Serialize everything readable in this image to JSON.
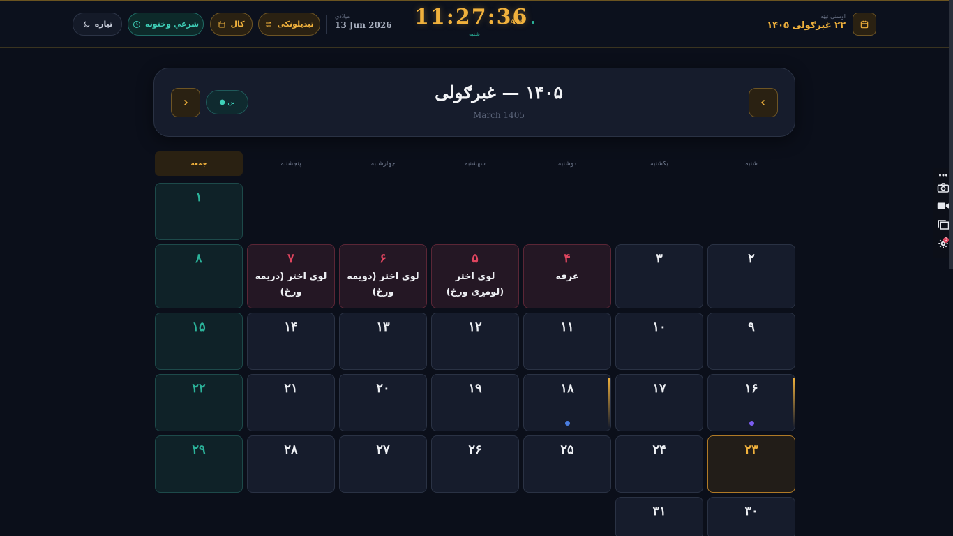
{
  "header": {
    "theme_label": "تیاره",
    "prayer_label": "شرعي وختونه",
    "year_label": "کال",
    "convert_label": "تبدیلونکی",
    "gregorian_label": "میلادي",
    "gregorian_date": "13 Jun 2026",
    "clock": "11:27:36",
    "ampm": "AM",
    "weekday": "شنبه",
    "solar_label": "اوسنی نیټه",
    "solar_date": "۲۳ غبرګولی ۱۴۰۵"
  },
  "month": {
    "title": "۱۴۰۵ — غبرګولی",
    "subtitle": "March 1405",
    "today_pill": "نن ●"
  },
  "weekdays": [
    "شنبه",
    "یکشنبه",
    "دوشنبه",
    "سهشنبه",
    "چهارشنبه",
    "پنجشنبه",
    "جمعه"
  ],
  "days": [
    {
      "n": "۱",
      "col": 6,
      "row": 0,
      "type": "fri"
    },
    {
      "n": "۲",
      "col": 0,
      "row": 1
    },
    {
      "n": "۳",
      "col": 1,
      "row": 1
    },
    {
      "n": "۴",
      "col": 2,
      "row": 1,
      "type": "holiday",
      "event": "عرفه"
    },
    {
      "n": "۵",
      "col": 3,
      "row": 1,
      "type": "holiday",
      "event": "لوی اختر (لومړی ورځ)"
    },
    {
      "n": "۶",
      "col": 4,
      "row": 1,
      "type": "holiday",
      "event": "لوی اختر (دویمه ورځ)"
    },
    {
      "n": "۷",
      "col": 5,
      "row": 1,
      "type": "holiday",
      "event": "لوی اختر (دریمه ورځ)"
    },
    {
      "n": "۸",
      "col": 6,
      "row": 1,
      "type": "fri"
    },
    {
      "n": "۹",
      "col": 0,
      "row": 2
    },
    {
      "n": "۱۰",
      "col": 1,
      "row": 2
    },
    {
      "n": "۱۱",
      "col": 2,
      "row": 2
    },
    {
      "n": "۱۲",
      "col": 3,
      "row": 2
    },
    {
      "n": "۱۳",
      "col": 4,
      "row": 2
    },
    {
      "n": "۱۴",
      "col": 5,
      "row": 2
    },
    {
      "n": "۱۵",
      "col": 6,
      "row": 2,
      "type": "fri"
    },
    {
      "n": "۱۶",
      "col": 0,
      "row": 3,
      "dot": "#7b5cf0",
      "stripe": true
    },
    {
      "n": "۱۷",
      "col": 1,
      "row": 3
    },
    {
      "n": "۱۸",
      "col": 2,
      "row": 3,
      "dot": "#4a7de0",
      "stripe": true
    },
    {
      "n": "۱۹",
      "col": 3,
      "row": 3
    },
    {
      "n": "۲۰",
      "col": 4,
      "row": 3
    },
    {
      "n": "۲۱",
      "col": 5,
      "row": 3
    },
    {
      "n": "۲۲",
      "col": 6,
      "row": 3,
      "type": "fri"
    },
    {
      "n": "۲۳",
      "col": 0,
      "row": 4,
      "type": "today"
    },
    {
      "n": "۲۴",
      "col": 1,
      "row": 4
    },
    {
      "n": "۲۵",
      "col": 2,
      "row": 4
    },
    {
      "n": "۲۶",
      "col": 3,
      "row": 4
    },
    {
      "n": "۲۷",
      "col": 4,
      "row": 4
    },
    {
      "n": "۲۸",
      "col": 5,
      "row": 4
    },
    {
      "n": "۲۹",
      "col": 6,
      "row": 4,
      "type": "fri"
    },
    {
      "n": "۳۰",
      "col": 0,
      "row": 5
    },
    {
      "n": "۳۱",
      "col": 1,
      "row": 5
    }
  ],
  "colors": {
    "accent_gold": "#f0b13c",
    "accent_teal": "#2bb39a",
    "holiday_red": "#e0455f",
    "background": "#0b0f1a"
  },
  "side_tools": {
    "icons": [
      "more-icon",
      "camera-icon",
      "video-icon",
      "copy-icon",
      "settings-icon"
    ],
    "badge": "3"
  }
}
